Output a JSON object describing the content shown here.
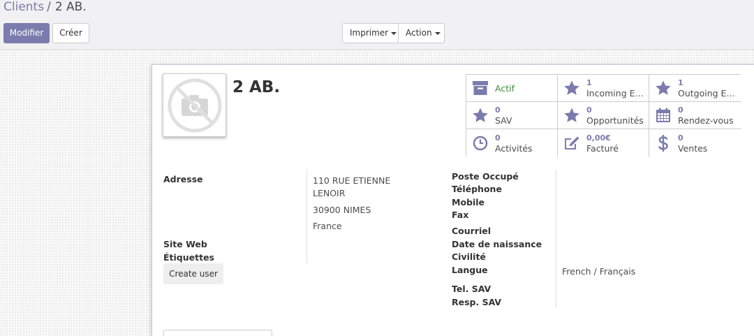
{
  "breadcrumb": {
    "parent": "Clients",
    "separator": "/",
    "current": "2 AB."
  },
  "toolbar": {
    "edit_label": "Modifier",
    "create_label": "Créer",
    "print_label": "Imprimer",
    "action_label": "Action"
  },
  "partner": {
    "name": "2 AB.",
    "address": {
      "street": "110 RUE ETIENNE",
      "street2": "LENOIR",
      "city_line": "30900 NIMES",
      "country": "France"
    },
    "language": "French / Français"
  },
  "smart_buttons": [
    {
      "icon": "archive-icon",
      "number": "",
      "label": "Actif"
    },
    {
      "icon": "star-icon",
      "number": "1",
      "label": "Incoming Em…"
    },
    {
      "icon": "star-icon",
      "number": "1",
      "label": "Outgoing Em…"
    },
    {
      "icon": "star-icon",
      "number": "0",
      "label": "SAV"
    },
    {
      "icon": "star-icon",
      "number": "0",
      "label": "Opportunités"
    },
    {
      "icon": "calendar-icon",
      "number": "0",
      "label": "Rendez-vous"
    },
    {
      "icon": "clock-icon",
      "number": "0",
      "label": "Activités"
    },
    {
      "icon": "edit-icon",
      "number": "0,00€",
      "label": "Facturé"
    },
    {
      "icon": "dollar-icon",
      "number": "0",
      "label": "Ventes"
    }
  ],
  "labels": {
    "address": "Adresse",
    "website": "Site Web",
    "tags": "Étiquettes",
    "job_position": "Poste Occupé",
    "phone": "Téléphone",
    "mobile": "Mobile",
    "fax": "Fax",
    "email": "Courriel",
    "birthdate": "Date de naissance",
    "title": "Civilité",
    "language": "Langue",
    "sav_phone": "Tel. SAV",
    "sav_resp": "Resp. SAV"
  },
  "create_user_label": "Create user",
  "colors": {
    "primary": "#7c7bad",
    "active_green": "#3c8a3c",
    "control_bg": "#f1f0f2"
  }
}
